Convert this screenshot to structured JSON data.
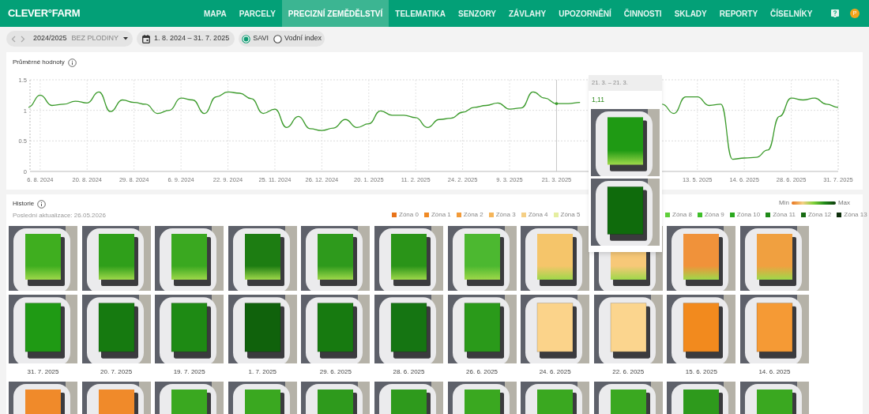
{
  "nav": {
    "logo": "CLEVER°FARM",
    "items": [
      {
        "label": "MAPA",
        "selected": false
      },
      {
        "label": "PARCELY",
        "selected": false
      },
      {
        "label": "PRECIZNÍ ZEMĚDĚLSTVÍ",
        "selected": true
      },
      {
        "label": "TELEMATIKA",
        "selected": false
      },
      {
        "label": "SENZORY",
        "selected": false
      },
      {
        "label": "ZÁVLAHY",
        "selected": false
      },
      {
        "label": "UPOZORNĚNÍ",
        "selected": false
      },
      {
        "label": "ČINNOSTI",
        "selected": false
      },
      {
        "label": "SKLADY",
        "selected": false
      },
      {
        "label": "REPORTY",
        "selected": false
      },
      {
        "label": "ČÍSELNÍKY",
        "selected": false
      }
    ],
    "avatar": "P"
  },
  "toolbar": {
    "season": "2024/2025",
    "crop": "BEZ PLODINY",
    "date_range": "1. 8. 2024 – 31. 7. 2025",
    "indices": [
      {
        "label": "SAVI",
        "selected": true
      },
      {
        "label": "Vodní index",
        "selected": false
      }
    ]
  },
  "average_values": {
    "title": "Průměrné hodnoty",
    "chart_data": {
      "type": "line",
      "series": [
        {
          "color": "#3a9a2a",
          "values": [
            1.05,
            1.25,
            1.08,
            1.1,
            1.15,
            1.12,
            1.3,
            0.98,
            1.17,
            1.13,
            1.1,
            0.95,
            1.0,
            1.2,
            1.17,
            0.95,
            1.22,
            1.3,
            1.28,
            1.19,
            0.95,
            1.02,
            0.72,
            0.9,
            0.7,
            0.67,
            0.71,
            0.85,
            0.72,
            0.78,
            0.99,
            0.92,
            0.92,
            0.88,
            0.72,
            0.85,
            0.87,
            0.97,
            1.05,
            1.08,
            1.12,
            1.02,
            1.04,
            1.3,
            1.2,
            1.11,
            1.11,
            1.13,
            null,
            null,
            null,
            null,
            null,
            null,
            1.1,
            0.95,
            1.22,
            1.22,
            1.08,
            1.1,
            0.2,
            0.22,
            0.23,
            0.35,
            0.9,
            1.2,
            1.17,
            1.2,
            1.1,
            1.05
          ]
        }
      ],
      "grid": true,
      "ylim": [
        0,
        1.5
      ],
      "yticks": [
        0,
        {
          "value": 0.5,
          "label": "0.5"
        },
        1,
        {
          "value": 1.5,
          "label": "1.5"
        }
      ],
      "categories": [
        null,
        "6. 8. 2024",
        null,
        null,
        null,
        "20. 8. 2024",
        null,
        null,
        null,
        "29. 8. 2024",
        null,
        null,
        null,
        "6. 9. 2024",
        null,
        null,
        null,
        "22. 9. 2024",
        null,
        null,
        null,
        "25. 11. 2024",
        null,
        null,
        null,
        "26. 12. 2024",
        null,
        null,
        null,
        "20. 1. 2025",
        null,
        null,
        null,
        "11. 2. 2025",
        null,
        null,
        null,
        "24. 2. 2025",
        null,
        null,
        null,
        "9. 3. 2025",
        null,
        null,
        null,
        "21. 3. 2025",
        null,
        null,
        null,
        null,
        null,
        null,
        null,
        null,
        null,
        null,
        null,
        "13. 5. 2025",
        null,
        null,
        null,
        "14. 6. 2025",
        null,
        null,
        null,
        "28. 6. 2025",
        null,
        null,
        null,
        "31. 7. 2025"
      ]
    },
    "tooltip": {
      "range": "21. 3. – 21. 3.",
      "value": "1,11",
      "images": [
        {
          "kind": "raw",
          "color": "#1f9a14"
        },
        {
          "kind": "zones",
          "color": "#0f6b0c"
        }
      ]
    }
  },
  "history": {
    "title": "Historie",
    "updated": "Poslední aktualizace: 26.05.2026",
    "scale_min": "Min",
    "scale_max": "Max",
    "zones": [
      {
        "label": "Zóna 0",
        "color": "#e8731a"
      },
      {
        "label": "Zóna 1",
        "color": "#f08a24"
      },
      {
        "label": "Zóna 2",
        "color": "#f29a38"
      },
      {
        "label": "Zóna 3",
        "color": "#f5b55a"
      },
      {
        "label": "Zóna 4",
        "color": "#f5cf85"
      },
      {
        "label": "Zóna 5",
        "color": "#e5eea0"
      },
      {
        "label": "Zóna 8",
        "color": "#5fcf3a"
      },
      {
        "label": "Zóna 9",
        "color": "#3fbf2a"
      },
      {
        "label": "Zóna 10",
        "color": "#2aa81e"
      },
      {
        "label": "Zóna 11",
        "color": "#1f8a18"
      },
      {
        "label": "Zóna 12",
        "color": "#176a12"
      },
      {
        "label": "Zóna 13",
        "color": "#0e2e0c"
      }
    ],
    "entries": [
      {
        "date": "31. 7. 2025",
        "image": {
          "color": "#3fae1f"
        },
        "zones": {
          "color": "#1f9a14"
        }
      },
      {
        "date": "20. 7. 2025",
        "image": {
          "color": "#2f9f1a"
        },
        "zones": {
          "color": "#167a10"
        }
      },
      {
        "date": "19. 7. 2025",
        "image": {
          "color": "#3aa820"
        },
        "zones": {
          "color": "#1e8a14"
        }
      },
      {
        "date": "1. 7. 2025",
        "image": {
          "color": "#1d7d12"
        },
        "zones": {
          "color": "#10620c"
        }
      },
      {
        "date": "29. 6. 2025",
        "image": {
          "color": "#2e9a1c"
        },
        "zones": {
          "color": "#177a10"
        }
      },
      {
        "date": "28. 6. 2025",
        "image": {
          "color": "#2a9418"
        },
        "zones": {
          "color": "#157512"
        }
      },
      {
        "date": "26. 6. 2025",
        "image": {
          "color": "#4cb830"
        },
        "zones": {
          "color": "#2a9a1a"
        }
      },
      {
        "date": "24. 6. 2025",
        "image": {
          "color": "#f5c56a"
        },
        "zones": {
          "color": "#fbd38a"
        }
      },
      {
        "date": "22. 6. 2025",
        "image": {
          "color": "#f7c878"
        },
        "zones": {
          "color": "#fbd58e"
        }
      },
      {
        "date": "15. 6. 2025",
        "image": {
          "color": "#f0923a"
        },
        "zones": {
          "color": "#f28a1e"
        }
      },
      {
        "date": "14. 6. 2025",
        "image": {
          "color": "#f0a040"
        },
        "zones": {
          "color": "#f59a35"
        }
      }
    ],
    "next_row": [
      {
        "color": "#f08a2a"
      },
      {
        "color": "#f08a2a"
      },
      {
        "color": "#3aa820"
      },
      {
        "color": "#3aa820"
      },
      {
        "color": "#2e9a1c"
      },
      {
        "color": "#2e9a1c"
      },
      {
        "color": "#3aa820"
      },
      {
        "color": "#3aa820"
      },
      {
        "color": "#3aa820"
      },
      {
        "color": "#2e9a1c"
      },
      {
        "color": "#3aa820"
      }
    ]
  }
}
